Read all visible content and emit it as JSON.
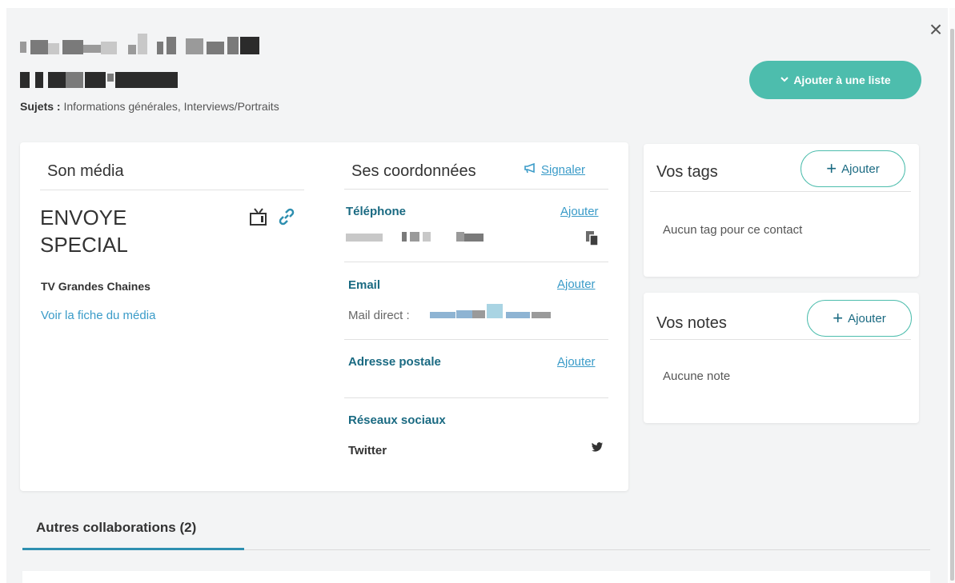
{
  "header": {
    "close_glyph": "×",
    "subjects_label": "Sujets :",
    "subjects_value": "Informations générales, Interviews/Portraits",
    "add_to_list_label": "Ajouter à une liste"
  },
  "media": {
    "title": "Son média",
    "name": "ENVOYE SPECIAL",
    "type": "TV Grandes Chaines",
    "link": "Voir la fiche du média"
  },
  "contact": {
    "title": "Ses coordonnées",
    "signal_label": "Signaler",
    "phone_label": "Téléphone",
    "email_label": "Email",
    "mail_direct_label": "Mail direct :",
    "address_label": "Adresse postale",
    "social_label": "Réseaux sociaux",
    "twitter_label": "Twitter",
    "add_label": "Ajouter"
  },
  "tags": {
    "title": "Vos tags",
    "add_label": "Ajouter",
    "empty": "Aucun tag pour ce contact"
  },
  "notes": {
    "title": "Vos notes",
    "add_label": "Ajouter",
    "empty": "Aucune note"
  },
  "collaborations": {
    "tab_label": "Autres collaborations (2)"
  },
  "colors": {
    "accent": "#4dbdad",
    "link": "#3a9bc8",
    "label": "#1a6a82",
    "background": "#f3f4f5"
  }
}
